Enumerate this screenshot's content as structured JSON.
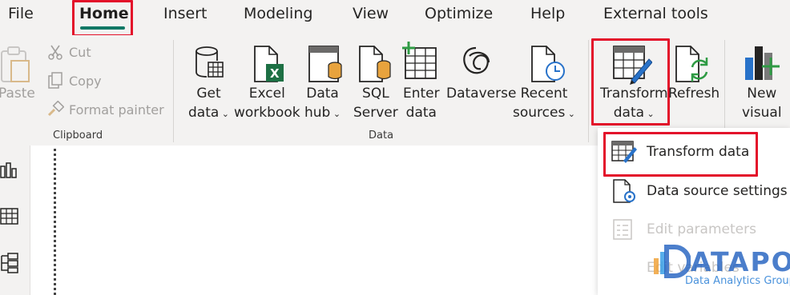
{
  "menu": {
    "items": [
      "File",
      "Home",
      "Insert",
      "Modeling",
      "View",
      "Optimize",
      "Help",
      "External tools"
    ],
    "active": "Home",
    "accent_color": "#117865",
    "highlight_color": "#e3102a"
  },
  "clipboard": {
    "paste": "Paste",
    "cut": "Cut",
    "copy": "Copy",
    "format_painter": "Format painter",
    "group_label": "Clipboard"
  },
  "data_group": {
    "get_data": [
      "Get",
      "data"
    ],
    "excel": [
      "Excel",
      "workbook"
    ],
    "data_hub": [
      "Data",
      "hub"
    ],
    "sql": [
      "SQL",
      "Server"
    ],
    "enter_data": [
      "Enter",
      "data"
    ],
    "dataverse": "Dataverse",
    "recent": [
      "Recent",
      "sources"
    ],
    "group_label": "Data"
  },
  "queries": {
    "transform": [
      "Transform",
      "data"
    ],
    "refresh": "Refresh"
  },
  "insert_group": {
    "new_visual": [
      "New",
      "visual"
    ]
  },
  "dropdown": {
    "items": [
      {
        "label": "Transform data",
        "icon": "transform-data-icon",
        "disabled": false
      },
      {
        "label": "Data source settings",
        "icon": "data-source-settings-icon",
        "disabled": false
      },
      {
        "label": "Edit parameters",
        "icon": "edit-parameters-icon",
        "disabled": true
      },
      {
        "label": "Edit variables",
        "icon": "edit-variables-icon",
        "disabled": true
      }
    ]
  },
  "watermark": {
    "title": "ATAPOT",
    "subtitle": "Data Analytics Group"
  }
}
